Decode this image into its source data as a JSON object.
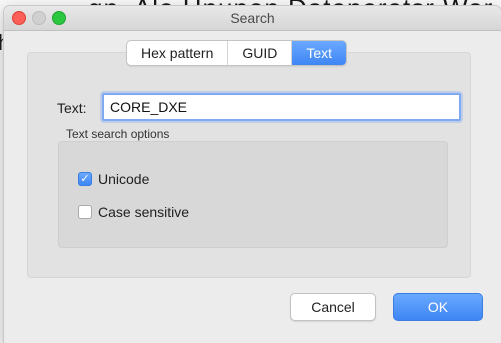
{
  "background": {
    "heading_fragment": "gn. Ale Hnunen Dateneretsr Wor",
    "letter_fragment": "h"
  },
  "window": {
    "title": "Search"
  },
  "tabs": [
    {
      "label": "Hex pattern",
      "active": false
    },
    {
      "label": "GUID",
      "active": false
    },
    {
      "label": "Text",
      "active": true
    }
  ],
  "form": {
    "text_label": "Text:",
    "text_value": "CORE_DXE",
    "options_heading": "Text search options",
    "options": [
      {
        "label": "Unicode",
        "checked": true
      },
      {
        "label": "Case sensitive",
        "checked": false
      }
    ]
  },
  "buttons": {
    "cancel": "Cancel",
    "ok": "OK"
  },
  "colors": {
    "accent": "#3f86f5",
    "close": "#fc5f57",
    "zoom": "#2ac73f"
  },
  "icons": {
    "checkbox_checked": "checkmark-icon"
  }
}
